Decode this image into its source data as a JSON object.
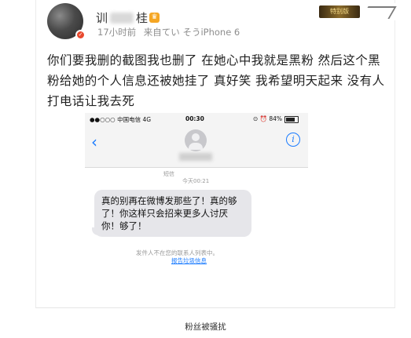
{
  "post": {
    "username_left": "训",
    "username_right": "桂",
    "vip_icon": "vip-crown-icon",
    "time_ago": "17小时前",
    "source": "来自てい そうiPhone 6",
    "badge_plate": "特别版",
    "text": "你们要我删的截图我也删了  在她心中我就是黑粉  然后这个黑粉给她的个人信息还被她挂了   真好笑  我希望明天起来 没有人打电话让我去死"
  },
  "screenshot": {
    "carrier": "●●○○○ 中国电信  4G",
    "time": "00:30",
    "status_right": "⊙ ⏰ 84%",
    "back_icon": "chevron-left-icon",
    "info_icon": "info-icon",
    "info_symbol": "i",
    "contact_icon": "contact-avatar-icon",
    "message_label": "短信",
    "message_time": "今天00:21",
    "message_text": "真的别再在微博发那些了！真的够了！你这样只会招来更多人讨厌你！够了！",
    "sender_note": "发件人不在您的联系人列表中。",
    "report_link": "报告垃圾信息"
  },
  "caption": "粉丝被骚扰",
  "colors": {
    "link_blue": "#1a7bff",
    "meta_gray": "#8d8d8d",
    "badge_red": "#e8492e",
    "vip_gold": "#f5a623"
  }
}
